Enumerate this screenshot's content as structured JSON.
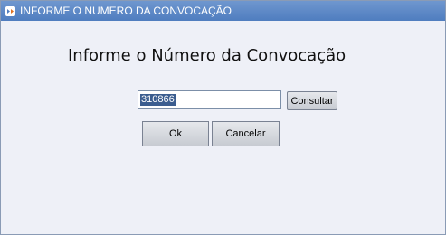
{
  "window": {
    "title": "INFORME O NUMERO DA CONVOCAÇÃO",
    "icon": "app-icon"
  },
  "dialog": {
    "heading": "Informe o Número da Convocação",
    "convocacao_input": {
      "value": "310866",
      "selected": true
    },
    "consultar_label": "Consultar",
    "ok_label": "Ok",
    "cancelar_label": "Cancelar"
  },
  "colors": {
    "titlebar": "#5b87c6",
    "background": "#eef0f7",
    "selection": "#3b5d8f"
  }
}
